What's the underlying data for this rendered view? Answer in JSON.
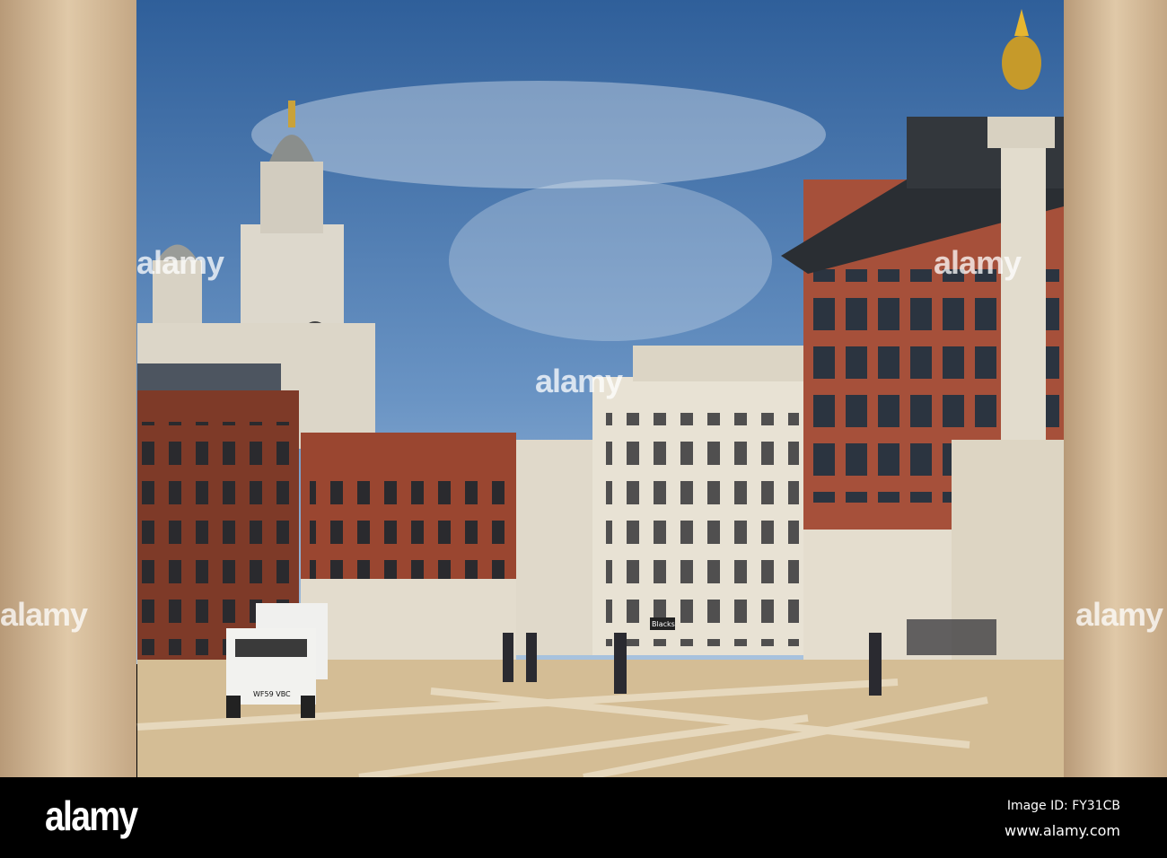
{
  "photo": {
    "watermark": "alamy",
    "shop_sign": "Blacks",
    "plate": "WF59 VBC"
  },
  "footer": {
    "logo": "alamy",
    "image_id": "Image ID: FY31CB",
    "site": "www.alamy.com"
  },
  "colors": {
    "sky": "#3e6ea8",
    "brick": "#8a3d28",
    "stone": "#e6e0d2",
    "paving": "#d6bf97"
  }
}
